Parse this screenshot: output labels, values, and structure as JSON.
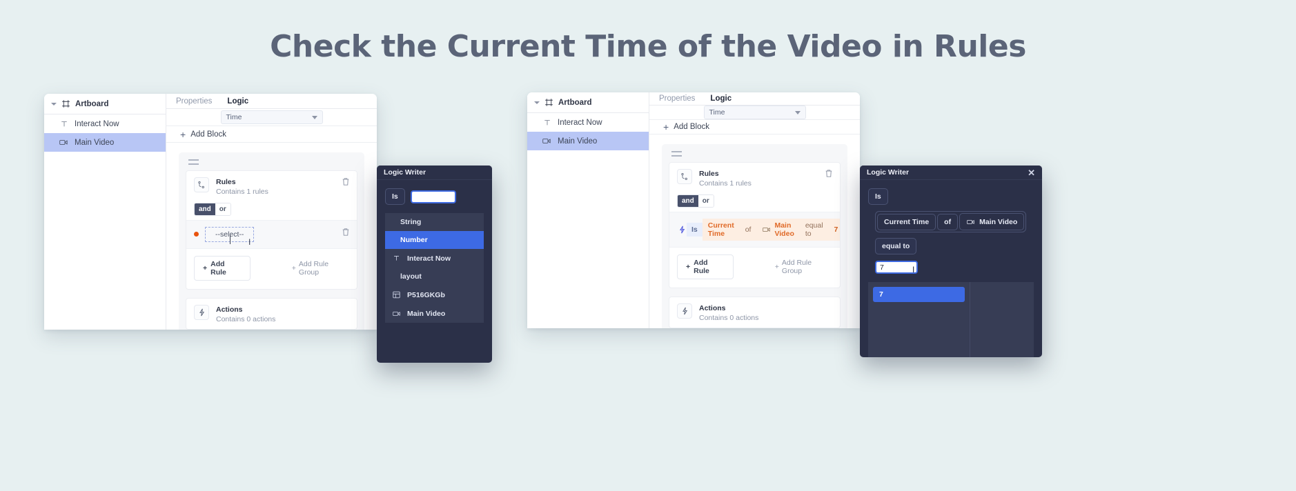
{
  "title": "Check the Current Time of the Video in Rules",
  "theme": {
    "background": "#e7f0f1",
    "title_color": "#5b6478",
    "accent_blue": "#3d6ae4",
    "selection_blue": "#b8c6f5",
    "token_orange": "#e06a28",
    "token_bg": "#fdeee2",
    "dark_panel": "#2b3048",
    "dark_list": "#373d55"
  },
  "left_card": {
    "sidebar": {
      "header": {
        "label": "Artboard",
        "icon": "artboard-icon",
        "caret": "chevron-down-icon"
      },
      "items": [
        {
          "label": "Interact Now",
          "icon": "text-icon",
          "selected": false
        },
        {
          "label": "Main Video",
          "icon": "video-icon",
          "selected": true
        }
      ]
    },
    "tabs": [
      {
        "label": "Properties",
        "active": false
      },
      {
        "label": "Logic",
        "active": true
      }
    ],
    "dropdown": {
      "value": "Time",
      "icon": "chevron-down-icon"
    },
    "add_block": {
      "label": "Add Block",
      "icon": "plus-icon"
    },
    "rules_panel": {
      "title": "Rules",
      "subtitle": "Contains 1 rules",
      "icon": "branch-icon",
      "delete_icon": "trash-icon",
      "conjunction": {
        "options": [
          "and",
          "or"
        ],
        "selected": "and"
      },
      "rule_value": "--select--",
      "buttons": {
        "add_rule": "Add Rule",
        "add_rule_group": "Add Rule Group"
      }
    },
    "actions_panel": {
      "title": "Actions",
      "subtitle": "Contains 0 actions",
      "icon": "bolt-icon"
    }
  },
  "right_card": {
    "sidebar": {
      "header": {
        "label": "Artboard",
        "icon": "artboard-icon",
        "caret": "chevron-down-icon"
      },
      "items": [
        {
          "label": "Interact Now",
          "icon": "text-icon",
          "selected": false
        },
        {
          "label": "Main Video",
          "icon": "video-icon",
          "selected": true
        }
      ]
    },
    "tabs": [
      {
        "label": "Properties",
        "active": false
      },
      {
        "label": "Logic",
        "active": true
      }
    ],
    "dropdown": {
      "value": "Time",
      "icon": "chevron-down-icon"
    },
    "add_block": {
      "label": "Add Block",
      "icon": "plus-icon"
    },
    "rules_panel": {
      "title": "Rules",
      "subtitle": "Contains 1 rules",
      "icon": "branch-icon",
      "delete_icon": "trash-icon",
      "conjunction": {
        "options": [
          "and",
          "or"
        ],
        "selected": "and"
      },
      "rule_tokens": {
        "is": "Is",
        "property": "Current Time",
        "of": "of",
        "target": "Main Video",
        "operator": "equal to",
        "value": "7"
      },
      "buttons": {
        "add_rule": "Add Rule",
        "add_rule_group": "Add Rule Group"
      }
    },
    "actions_panel": {
      "title": "Actions",
      "subtitle": "Contains 0 actions",
      "icon": "bolt-icon"
    }
  },
  "logic_writer_left": {
    "title": "Logic Writer",
    "is_chip": "Is",
    "input_value": "",
    "options": [
      {
        "label": "String",
        "icon": null,
        "selected": false
      },
      {
        "label": "Number",
        "icon": null,
        "selected": true
      },
      {
        "label": "Interact Now",
        "icon": "text-icon",
        "selected": false
      },
      {
        "label": "layout",
        "icon": null,
        "selected": false
      },
      {
        "label": "P516GKGb",
        "icon": "table-icon",
        "selected": false
      },
      {
        "label": "Main Video",
        "icon": "video-icon",
        "selected": false
      }
    ]
  },
  "logic_writer_right": {
    "title": "Logic Writer",
    "close_icon": "close-icon",
    "is_chip": "Is",
    "tokens": {
      "property": "Current Time",
      "of": "of",
      "target": "Main Video",
      "operator": "equal to"
    },
    "input_value": "7",
    "suggestions": [
      "7"
    ]
  }
}
